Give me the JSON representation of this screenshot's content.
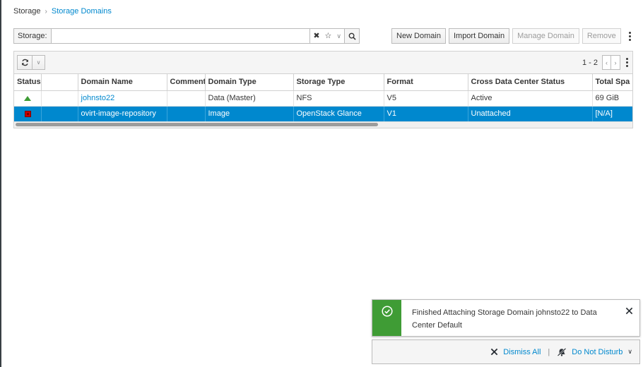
{
  "breadcrumb": {
    "root": "Storage",
    "separator": "›",
    "current": "Storage Domains"
  },
  "search": {
    "label": "Storage:",
    "value": "",
    "placeholder": ""
  },
  "actions": {
    "new_domain": "New Domain",
    "import_domain": "Import Domain",
    "manage_domain": "Manage Domain",
    "remove": "Remove"
  },
  "pager": {
    "count": "1 - 2",
    "prev": "‹",
    "next": "›"
  },
  "table": {
    "columns": [
      "Status",
      "",
      "Domain Name",
      "Comment",
      "Domain Type",
      "Storage Type",
      "Format",
      "Cross Data Center Status",
      "Total Spa"
    ],
    "rows": [
      {
        "status": "up",
        "domain_name": "johnsto22",
        "comment": "",
        "domain_type": "Data (Master)",
        "storage_type": "NFS",
        "format": "V5",
        "cross_dc_status": "Active",
        "total_space": "69 GiB",
        "selected": false
      },
      {
        "status": "unattached",
        "domain_name": "ovirt-image-repository",
        "comment": "",
        "domain_type": "Image",
        "storage_type": "OpenStack Glance",
        "format": "V1",
        "cross_dc_status": "Unattached",
        "total_space": "[N/A]",
        "selected": true
      }
    ]
  },
  "notification": {
    "message": "Finished Attaching Storage Domain johnsto22 to Data Center Default",
    "dismiss_all": "Dismiss All",
    "separator": "|",
    "do_not_disturb": "Do Not Disturb"
  },
  "colors": {
    "accent": "#0088ce",
    "success": "#3f9c35",
    "danger": "#cc0000"
  }
}
